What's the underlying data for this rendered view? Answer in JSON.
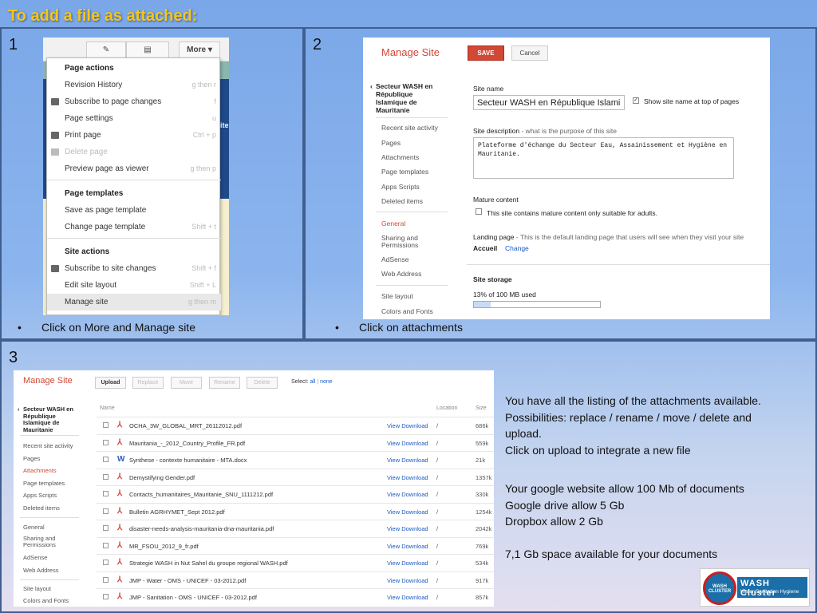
{
  "title": "To add a file as attached:",
  "panels": {
    "p1": {
      "number": "1",
      "caption": "Click on More and Manage site"
    },
    "p2": {
      "number": "2",
      "caption": "Click on attachments"
    },
    "p3": {
      "number": "3"
    }
  },
  "bullet": "•",
  "screen1": {
    "more_label": "More",
    "menu": {
      "page_actions": "Page actions",
      "revision_history": {
        "label": "Revision History",
        "shortcut": "g then r"
      },
      "subscribe_page": {
        "label": "Subscribe to page changes",
        "shortcut": "f"
      },
      "page_settings": {
        "label": "Page settings",
        "shortcut": "u"
      },
      "print_page": {
        "label": "Print page",
        "shortcut": "Ctrl + p"
      },
      "delete_page": {
        "label": "Delete page",
        "shortcut": ""
      },
      "preview_viewer": {
        "label": "Preview page as viewer",
        "shortcut": "g then p"
      },
      "page_templates": "Page templates",
      "save_template": {
        "label": "Save as page template",
        "shortcut": ""
      },
      "change_template": {
        "label": "Change page template",
        "shortcut": "Shift + t"
      },
      "site_actions": "Site actions",
      "subscribe_site": {
        "label": "Subscribe to site changes",
        "shortcut": "Shift + f"
      },
      "edit_layout": {
        "label": "Edit site layout",
        "shortcut": "Shift + L"
      },
      "manage_site": {
        "label": "Manage site",
        "shortcut": "g then m"
      }
    },
    "edge_text": "ite"
  },
  "screen2": {
    "title": "Manage Site",
    "save": "SAVE",
    "cancel": "Cancel",
    "site": "Secteur WASH en République Islamique de Mauritanie",
    "nav": [
      "Recent site activity",
      "Pages",
      "Attachments",
      "Page templates",
      "Apps Scripts",
      "Deleted items",
      "General",
      "Sharing and Permissions",
      "AdSense",
      "Web Address",
      "Site layout",
      "Colors and Fonts"
    ],
    "site_name_label": "Site name",
    "site_name_value": "Secteur WASH en République Islami",
    "show_name": "Show site name at top of pages",
    "desc_label": "Site description",
    "desc_hint": " - what is the purpose of this site",
    "desc_value": "Plateforme d'échange du Secteur Eau, Assainissement et Hygiène en Mauritanie.",
    "mature_label": "Mature content",
    "mature_text": "This site contains mature content only suitable for adults.",
    "landing_label": "Landing page",
    "landing_hint": " - This is the default landing page that users will see when they visit your site",
    "landing_value": "Accueil",
    "landing_change": "Change",
    "storage_label": "Site storage",
    "storage_text": "13% of 100 MB used",
    "storage_pct": 13
  },
  "screen3": {
    "title": "Manage Site",
    "buttons": {
      "upload": "Upload",
      "replace": "Replace",
      "move": "Move",
      "rename": "Rename",
      "delete": "Delete"
    },
    "select_label": "Select:",
    "select_all": "all",
    "select_sep": "|",
    "select_none": "none",
    "site": "Secteur WASH en République Islamique de Mauritanie",
    "nav": [
      "Recent site activity",
      "Pages",
      "Attachments",
      "Page templates",
      "Apps Scripts",
      "Deleted items",
      "General",
      "Sharing and Permissions",
      "AdSense",
      "Web Address",
      "Site layout",
      "Colors and Fonts"
    ],
    "headers": {
      "name": "Name",
      "location": "Location",
      "size": "Size"
    },
    "view_download": "View Download",
    "files": [
      {
        "icon": "pdf",
        "name": "OCHA_3W_GLOBAL_MRT_26112012.pdf",
        "location": "/",
        "size": "686k"
      },
      {
        "icon": "pdf",
        "name": "Mauritania_-_2012_Country_Profile_FR.pdf",
        "location": "/",
        "size": "559k"
      },
      {
        "icon": "doc",
        "name": "Synthese - contexte humanitaire - MTA.docx",
        "location": "/",
        "size": "21k"
      },
      {
        "icon": "pdf",
        "name": "Demystifying Gender.pdf",
        "location": "/",
        "size": "1357k"
      },
      {
        "icon": "pdf",
        "name": "Contacts_humanitaires_Mauritanie_SNU_1111212.pdf",
        "location": "/",
        "size": "330k"
      },
      {
        "icon": "pdf",
        "name": "Bulletin AGRHYMET_Sept 2012.pdf",
        "location": "/",
        "size": "1254k"
      },
      {
        "icon": "pdf",
        "name": "disaster-needs-analysis-mauritania-dna-mauritania.pdf",
        "location": "/",
        "size": "2042k"
      },
      {
        "icon": "pdf",
        "name": "MR_FSOU_2012_9_fr.pdf",
        "location": "/",
        "size": "769k"
      },
      {
        "icon": "pdf",
        "name": "Strategie WASH in Nut Sahel du groupe regional WASH.pdf",
        "location": "/",
        "size": "534k"
      },
      {
        "icon": "pdf",
        "name": "JMP - Water - OMS - UNICEF - 03-2012.pdf",
        "location": "/",
        "size": "917k"
      },
      {
        "icon": "pdf",
        "name": "JMP - Sanitation - OMS - UNICEF - 03-2012.pdf",
        "location": "/",
        "size": "857k"
      }
    ]
  },
  "info": {
    "lines_a": [
      "You have all the listing of the attachments available.",
      "Possibilities: replace / rename / move / delete and",
      "upload.",
      "Click on upload to integrate a new file"
    ],
    "lines_b": [
      "Your google website allow 100 Mb of documents",
      "Google drive allow 5 Gb",
      "Dropbox allow 2 Gb"
    ],
    "line_c": "7,1 Gb space available for your documents"
  },
  "logo": {
    "seal": "WASH CLUSTER",
    "name": "WASH Cluster",
    "tagline": "Water Sanitation Hygiene"
  },
  "icons": {
    "edit": "pencil-icon",
    "page": "page-icon",
    "dropdown": "chevron-down-icon",
    "pdf": "pdf-icon",
    "doc": "word-icon",
    "back": "chevron-left-icon"
  },
  "colors": {
    "title": "#f5c518",
    "accent_red": "#d14836",
    "link": "#1a5bc4"
  }
}
